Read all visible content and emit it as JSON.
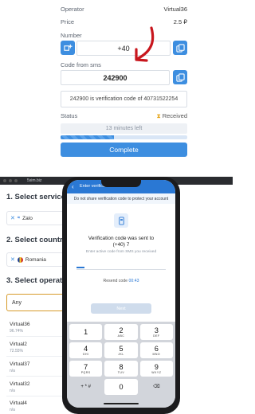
{
  "order": {
    "operator_label": "Operator",
    "operator_value": "Virtual36",
    "price_label": "Price",
    "price_value": "2.5 ₽",
    "number_label": "Number",
    "number_value": "+40",
    "code_label": "Code from sms",
    "code_value": "242900",
    "sms_text": "242900 is verification code of 40731522254",
    "status_label": "Status",
    "status_value": "Received",
    "time_left": "13 minutes left",
    "progress_fraction": 0.42,
    "complete_label": "Complete",
    "accent_color": "#3d8ee0"
  },
  "browser": {
    "url": "5sim.biz"
  },
  "site": {
    "section_service": "1. Select service",
    "service_chip": "Zalo",
    "section_country": "2. Select country",
    "country_chip": "Romania",
    "section_operator": "3. Select operator",
    "operator_any": "Any",
    "operators": [
      {
        "name": "Virtual36",
        "sub": "96.74%"
      },
      {
        "name": "Virtual2",
        "sub": "72.55%"
      },
      {
        "name": "Virtual37",
        "sub": "n/a"
      },
      {
        "name": "Virtual32",
        "sub": "n/a"
      },
      {
        "name": "Virtual4",
        "sub": "n/a"
      }
    ]
  },
  "phone": {
    "header_title": "Enter verification code",
    "warning": "Do not share verification code to protect your account",
    "sent_line1": "Verification code was sent to",
    "sent_line2": "(+40) 7",
    "hint": "Enter active code from SMS you received",
    "resend_label": "Resend code",
    "resend_timer": "00:43",
    "next_label": "Next",
    "keys": [
      {
        "d": "1",
        "l": ""
      },
      {
        "d": "2",
        "l": "ABC"
      },
      {
        "d": "3",
        "l": "DEF"
      },
      {
        "d": "4",
        "l": "GHI"
      },
      {
        "d": "5",
        "l": "JKL"
      },
      {
        "d": "6",
        "l": "MNO"
      },
      {
        "d": "7",
        "l": "PQRS"
      },
      {
        "d": "8",
        "l": "TUV"
      },
      {
        "d": "9",
        "l": "WXYZ"
      },
      {
        "d": "+ * #",
        "l": ""
      },
      {
        "d": "0",
        "l": ""
      },
      {
        "d": "⌫",
        "l": ""
      }
    ]
  }
}
